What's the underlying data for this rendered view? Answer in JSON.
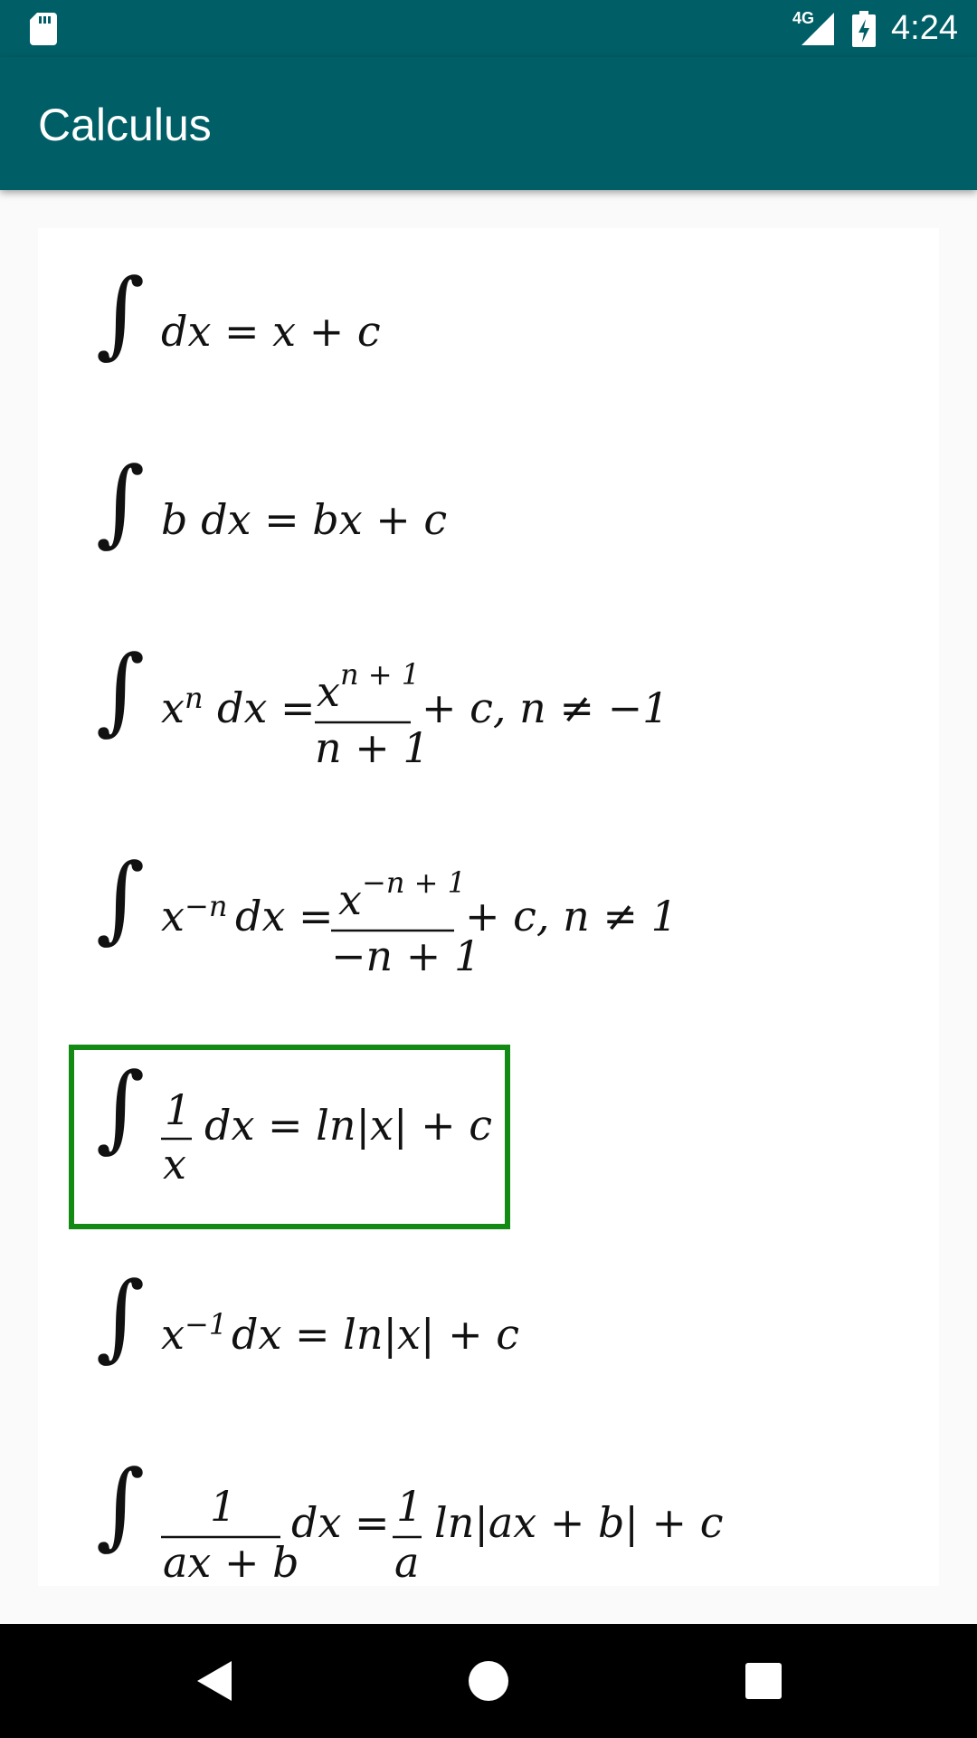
{
  "status_bar": {
    "network": "4G",
    "time": "4:24"
  },
  "app_bar": {
    "title": "Calculus"
  },
  "formulas": {
    "f1": {
      "left": "dx = x + c"
    },
    "f2": {
      "left": "b dx = bx + c"
    },
    "f3": {
      "base": "x",
      "exp": "n",
      "mid": "dx =",
      "num_base": "x",
      "num_exp": "n + 1",
      "den": "n + 1",
      "tail": "+ c, n ≠ −1"
    },
    "f4": {
      "base": "x",
      "exp": "−n",
      "mid": "dx =",
      "num_base": "x",
      "num_exp": "−n + 1",
      "den": "−n + 1",
      "tail": "+ c, n ≠ 1"
    },
    "f5": {
      "num": "1",
      "den": "x",
      "tail": "dx = ln|x| + c"
    },
    "f6": {
      "base": "x",
      "exp": "−1",
      "tail": "dx = ln|x| + c"
    },
    "f7": {
      "num": "1",
      "den": "ax + b",
      "mid": "dx =",
      "num2": "1",
      "den2": "a",
      "tail": "ln|ax + b| + c"
    }
  },
  "colors": {
    "primary": "#005e66",
    "highlight": "#138a13"
  },
  "icons": [
    "sd-card-icon",
    "signal-icon",
    "battery-charging-icon",
    "back-icon",
    "home-icon",
    "recents-icon"
  ]
}
